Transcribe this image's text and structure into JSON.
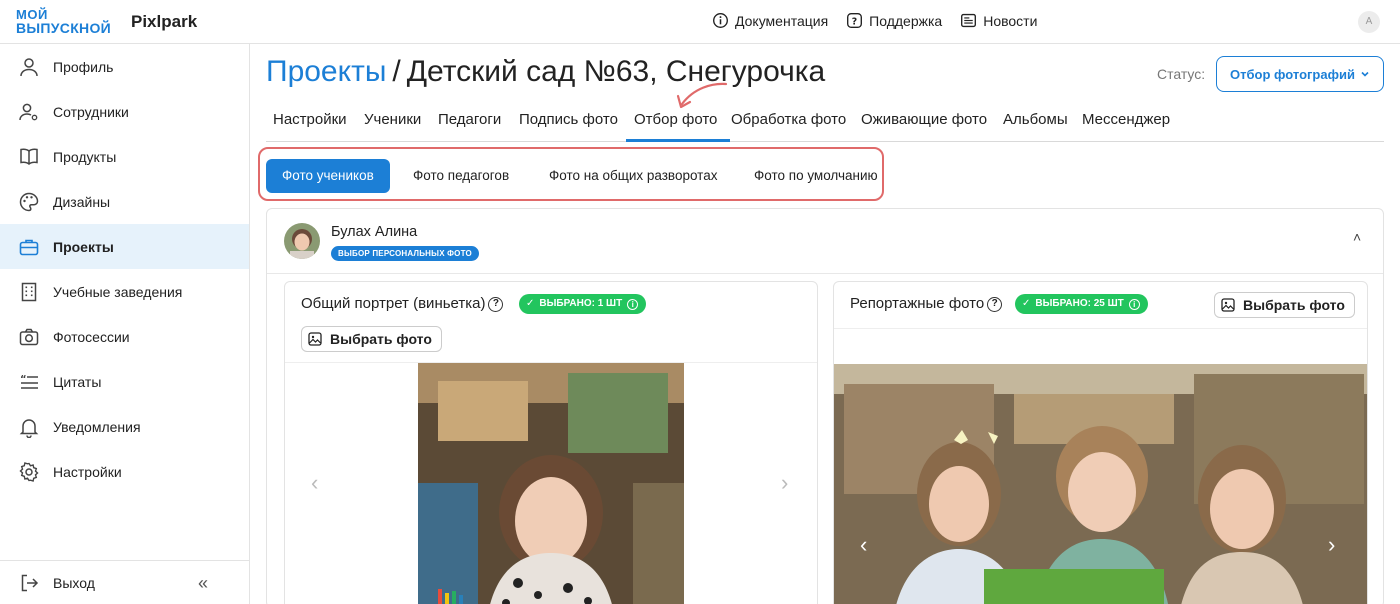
{
  "header": {
    "logo_line1": "МОЙ",
    "logo_line2": "ВЫПУСКНОЙ",
    "brand": "Pixlpark",
    "nav": [
      {
        "label": "Документация",
        "icon": "info-icon"
      },
      {
        "label": "Поддержка",
        "icon": "help-icon"
      },
      {
        "label": "Новости",
        "icon": "news-icon"
      }
    ],
    "avatar_letter": "A"
  },
  "sidebar": {
    "items": [
      {
        "label": "Профиль",
        "icon": "user-icon",
        "active": false
      },
      {
        "label": "Сотрудники",
        "icon": "staff-icon",
        "active": false
      },
      {
        "label": "Продукты",
        "icon": "book-icon",
        "active": false
      },
      {
        "label": "Дизайны",
        "icon": "palette-icon",
        "active": false
      },
      {
        "label": "Проекты",
        "icon": "briefcase-icon",
        "active": true
      },
      {
        "label": "Учебные заведения",
        "icon": "building-icon",
        "active": false
      },
      {
        "label": "Фотосессии",
        "icon": "camera-icon",
        "active": false
      },
      {
        "label": "Цитаты",
        "icon": "quote-icon",
        "active": false
      },
      {
        "label": "Уведомления",
        "icon": "bell-icon",
        "active": false
      },
      {
        "label": "Настройки",
        "icon": "gear-icon",
        "active": false
      }
    ],
    "logout": "Выход",
    "collapse": "«"
  },
  "page": {
    "breadcrumb": "Проекты",
    "separator": "/",
    "project_name": "Детский сад №63, Снегурочка",
    "status_label": "Статус:",
    "status_value": "Отбор фотографий"
  },
  "tabs": [
    "Настройки",
    "Ученики",
    "Педагоги",
    "Подпись фото",
    "Отбор фото",
    "Обработка фото",
    "Оживающие фото",
    "Альбомы",
    "Мессенджер"
  ],
  "active_tab": "Отбор фото",
  "subtabs": [
    "Фото учеников",
    "Фото педагогов",
    "Фото на общих разворотах",
    "Фото по умолчанию"
  ],
  "active_subtab": "Фото учеников",
  "student": {
    "name": "Булах Алина",
    "badge": "ВЫБОР ПЕРСОНАЛЬНЫХ ФОТО"
  },
  "panels": [
    {
      "title": "Общий портрет (виньетка)",
      "selected": "ВЫБРАНО: 1 ШТ",
      "button": "Выбрать фото"
    },
    {
      "title": "Репортажные фото",
      "selected": "ВЫБРАНО: 25 ШТ",
      "button": "Выбрать фото"
    }
  ],
  "colors": {
    "accent": "#1c7fd6",
    "success": "#22c55e",
    "highlight": "#e06a6a",
    "active_bg": "#e6f2fb"
  }
}
